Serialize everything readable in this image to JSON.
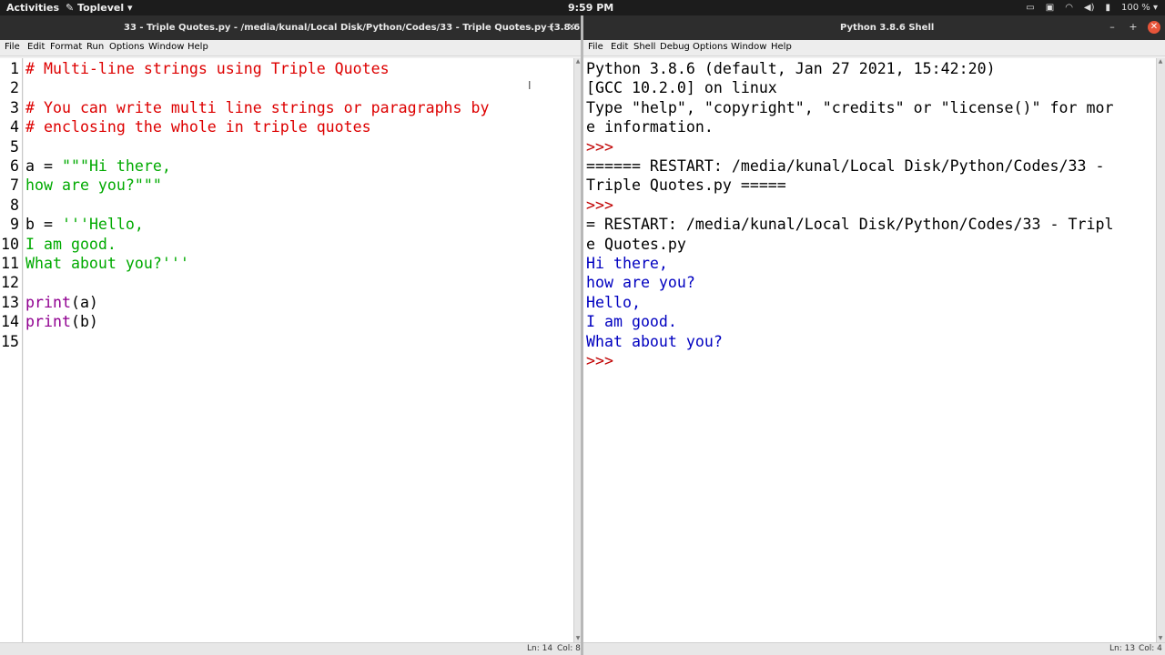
{
  "topbar": {
    "activities": "Activities",
    "app_menu": "Toplevel ▾",
    "clock": "9:59 PM",
    "battery": "100 % ▾"
  },
  "editor_window": {
    "title": "33 - Triple Quotes.py - /media/kunal/Local Disk/Python/Codes/33 - Triple Quotes.py (3.8.6)",
    "menu": [
      "File",
      "Edit",
      "Format",
      "Run",
      "Options",
      "Window",
      "Help"
    ],
    "line_numbers": [
      "1",
      "2",
      "3",
      "4",
      "5",
      "6",
      "7",
      "8",
      "9",
      "10",
      "11",
      "12",
      "13",
      "14",
      "15"
    ],
    "status": {
      "ln": "Ln: 14",
      "col": "Col: 8"
    }
  },
  "code": {
    "l1": "# Multi-line strings using Triple Quotes",
    "l3": "# You can write multi line strings or paragraphs by",
    "l4": "# enclosing the whole in triple quotes",
    "l6a": "a = ",
    "l6b": "\"\"\"Hi there,",
    "l7": "how are you?\"\"\"",
    "l9a": "b = ",
    "l9b": "'''Hello,",
    "l10": "I am good.",
    "l11": "What about you?'''",
    "l13a": "print",
    "l13b": "(a)",
    "l14a": "print",
    "l14b": "(b)"
  },
  "shell_window": {
    "title": "Python 3.8.6 Shell",
    "menu": [
      "File",
      "Edit",
      "Shell",
      "Debug",
      "Options",
      "Window",
      "Help"
    ],
    "status": {
      "ln": "Ln: 13",
      "col": "Col: 4"
    }
  },
  "shell": {
    "s1": "Python 3.8.6 (default, Jan 27 2021, 15:42:20)",
    "s2": "[GCC 10.2.0] on linux",
    "s3": "Type \"help\", \"copyright\", \"credits\" or \"license()\" for mor",
    "s4": "e information.",
    "s5": ">>>",
    "s6": "====== RESTART: /media/kunal/Local Disk/Python/Codes/33 -",
    "s7": "Triple Quotes.py =====",
    "s8": ">>>",
    "s9": "= RESTART: /media/kunal/Local Disk/Python/Codes/33 - Tripl",
    "s10": "e Quotes.py",
    "s11": "Hi there,",
    "s12": "how are you?",
    "s13": "Hello,",
    "s14": "I am good.",
    "s15": "What about you?",
    "s16": ">>>"
  }
}
